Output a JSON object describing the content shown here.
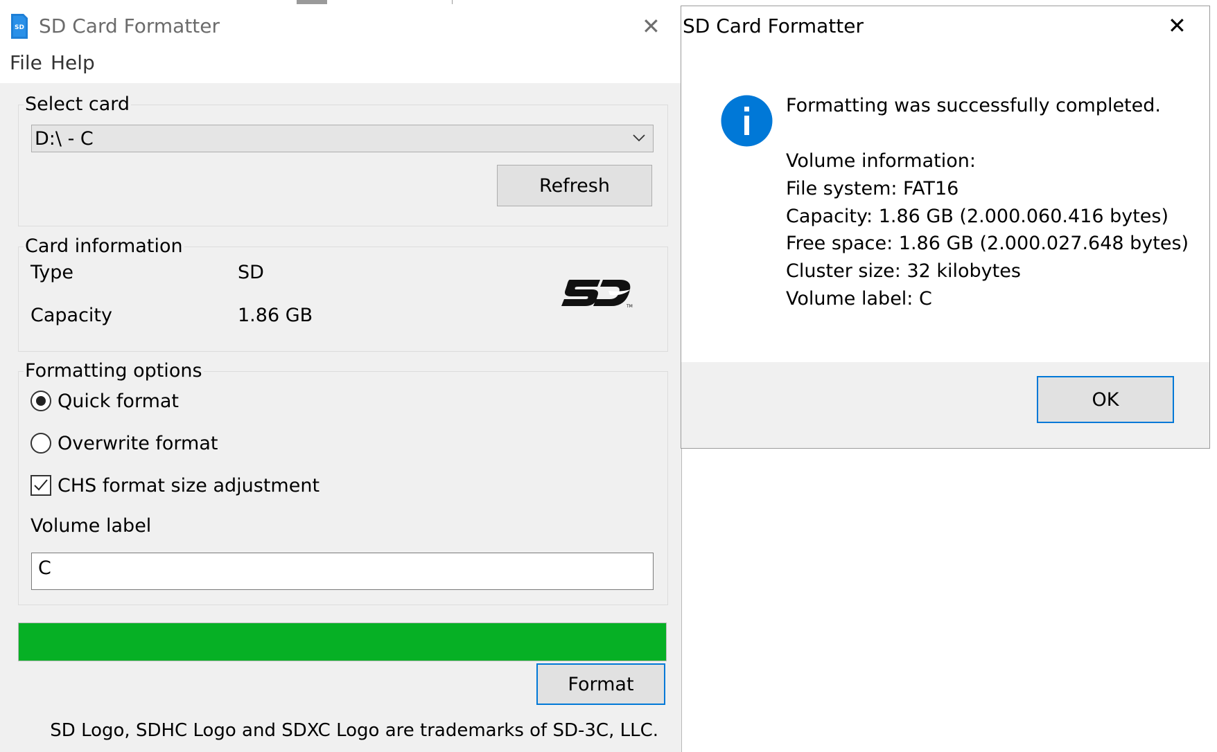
{
  "main_window": {
    "title": "SD Card Formatter",
    "menu": [
      "File",
      "Help"
    ],
    "select_card": {
      "label": "Select card",
      "selected": "D:\\ - C",
      "refresh_label": "Refresh"
    },
    "card_info": {
      "label": "Card information",
      "rows": [
        {
          "key": "Type",
          "value": "SD"
        },
        {
          "key": "Capacity",
          "value": "1.86 GB"
        }
      ]
    },
    "formatting_options": {
      "label": "Formatting options",
      "quick_format": "Quick format",
      "overwrite_format": "Overwrite format",
      "chs_adjust": "CHS format size adjustment",
      "selected": "Quick format",
      "chs_checked": true,
      "volume_label_caption": "Volume label",
      "volume_label_value": "C"
    },
    "progress": 1.0,
    "format_label": "Format",
    "footer": "SD Logo, SDHC Logo and SDXC Logo are trademarks of SD-3C, LLC."
  },
  "dialog": {
    "title": "SD Card Formatter",
    "message": "Formatting was successfully completed.",
    "details": [
      "Volume information:",
      "File system: FAT16",
      "Capacity: 1.86 GB (2.000.060.416 bytes)",
      "Free space: 1.86 GB (2.000.027.648 bytes)",
      "Cluster size: 32 kilobytes",
      "Volume label: C"
    ],
    "ok_label": "OK"
  },
  "colors": {
    "progress_fill": "#06b025",
    "info_icon": "#0078d7",
    "focus_border": "#0078d7"
  }
}
